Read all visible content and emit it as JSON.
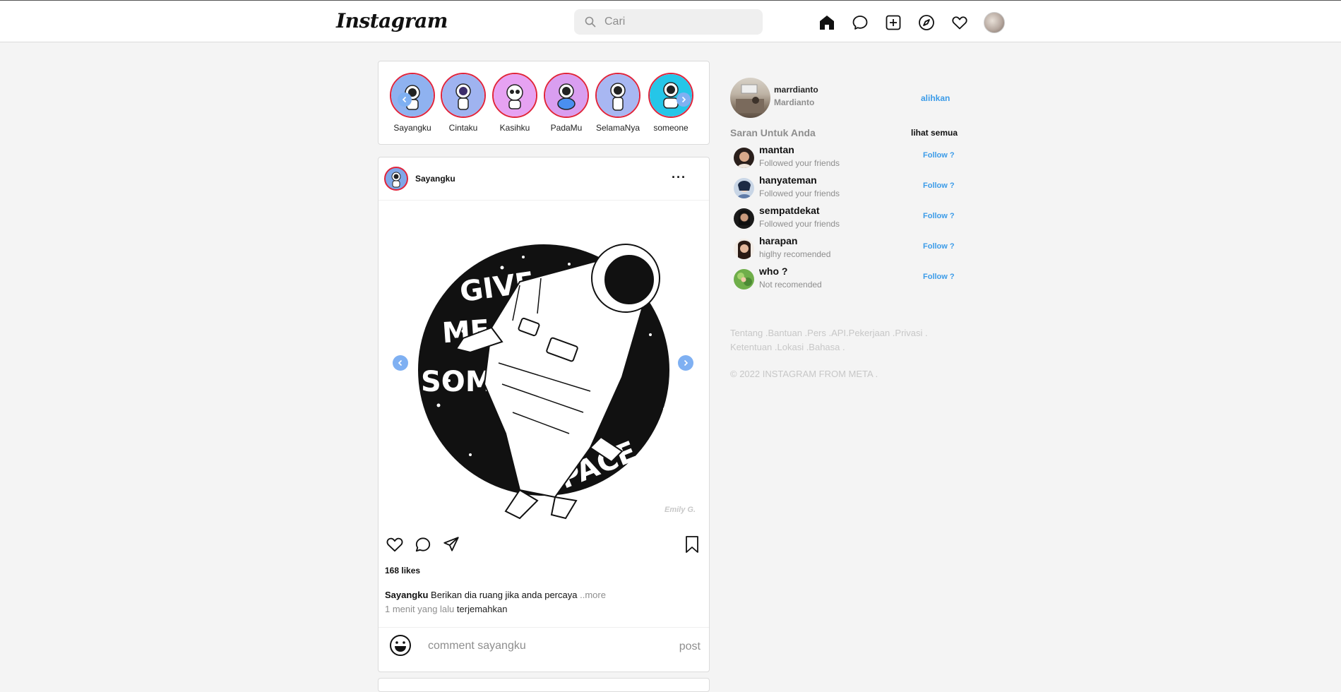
{
  "nav": {
    "logo": "Instagram",
    "search_placeholder": "Cari",
    "icons": [
      "home-icon",
      "messenger-icon",
      "new-post-icon",
      "explore-icon",
      "activity-heart-icon",
      "profile-avatar"
    ]
  },
  "stories": [
    {
      "label": "Sayangku",
      "bg": "#8fb2f0"
    },
    {
      "label": "Cintaku",
      "bg": "#9fb3f0"
    },
    {
      "label": "Kasihku",
      "bg": "#e6a2f2"
    },
    {
      "label": "PadaMu",
      "bg": "#d99ef0"
    },
    {
      "label": "SelamaNya",
      "bg": "#a8b7f2"
    },
    {
      "label": "someone",
      "bg": "#25c6e8"
    }
  ],
  "post": {
    "username": "Sayangku",
    "more": "···",
    "signature": "Emily G.",
    "likes": "168 likes",
    "caption_user": "Sayangku",
    "caption_text": "Berikan dia ruang jika anda percaya",
    "caption_more": "..more",
    "time": "1 menit yang lalu",
    "translate": "terjemahkan",
    "comment_placeholder": "comment sayangku",
    "post_button": "post"
  },
  "sidebar": {
    "username": "marrdianto",
    "name": "Mardianto",
    "switch": "alihkan",
    "suggestions_title": "Saran Untuk Anda",
    "see_all": "lihat semua",
    "suggestions": [
      {
        "name": "mantan",
        "sub": "Followed your friends",
        "follow": "Follow ?"
      },
      {
        "name": "hanyateman",
        "sub": "Followed your friends",
        "follow": "Follow ?"
      },
      {
        "name": "sempatdekat",
        "sub": "Followed your friends",
        "follow": "Follow ?"
      },
      {
        "name": "harapan",
        "sub": "higlhy recomended",
        "follow": "Follow ?"
      },
      {
        "name": "who ?",
        "sub": "Not recomended",
        "follow": "Follow ?"
      }
    ],
    "footer_links": "Tentang .Bantuan .Pers .API.Pekerjaan .Privasi . Ketentuan .Lokasi .Bahasa .",
    "copyright": "© 2022 INSTAGRAM FROM META ."
  }
}
